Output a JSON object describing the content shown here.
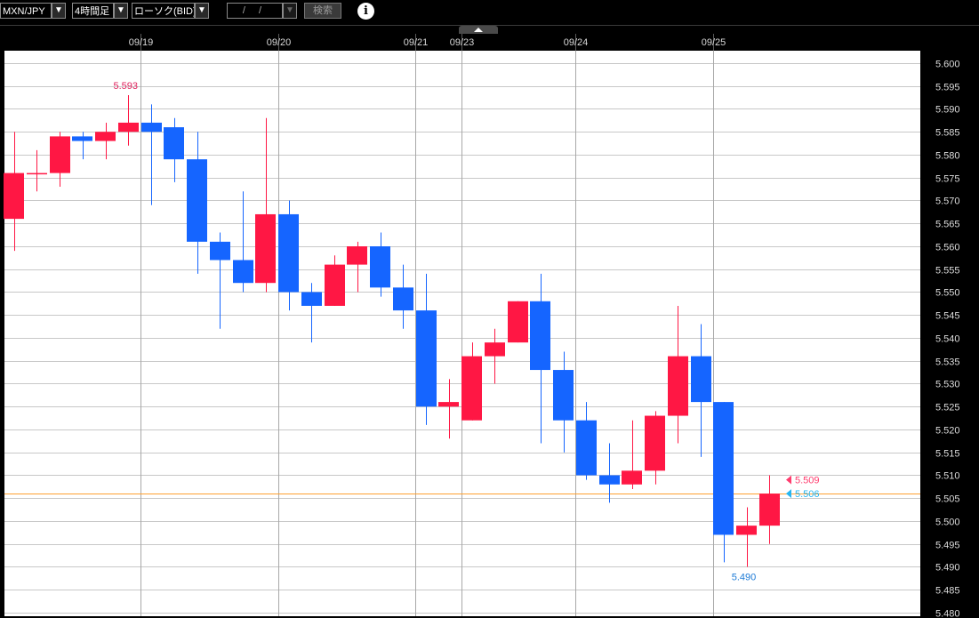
{
  "toolbar": {
    "symbol": "MXN/JPY",
    "timeframe": "4時間足",
    "chart_style": "ローソク(BID)",
    "date_input": "/ /",
    "search_label": "検索",
    "info_icon": "info-icon"
  },
  "colors": {
    "up": "#ff1744",
    "down": "#1565ff",
    "price_line": "#ffa030",
    "bid_marker": "#ff3c6e",
    "ask_marker": "#26b6f0",
    "background": "#000000",
    "plot": "#ffffff"
  },
  "chart_data": {
    "type": "candlestick",
    "title": "",
    "xlabel": "",
    "ylabel": "",
    "ylim": [
      5.488,
      5.602
    ],
    "y_ticks": [
      "5.600",
      "5.595",
      "5.590",
      "5.585",
      "5.580",
      "5.575",
      "5.570",
      "5.565",
      "5.560",
      "5.555",
      "5.550",
      "5.545",
      "5.540",
      "5.535",
      "5.530",
      "5.525",
      "5.520",
      "5.515",
      "5.510",
      "5.505",
      "5.500",
      "5.495",
      "5.490",
      "5.485",
      "5.480"
    ],
    "date_labels": [
      {
        "label": "09/19",
        "bar": 6
      },
      {
        "label": "09/20",
        "bar": 12
      },
      {
        "label": "09/21",
        "bar": 18
      },
      {
        "label": "09/23",
        "bar": 20
      },
      {
        "label": "09/24",
        "bar": 25
      },
      {
        "label": "09/25",
        "bar": 31
      }
    ],
    "candles": [
      {
        "o": 5.566,
        "h": 5.585,
        "l": 5.559,
        "c": 5.576
      },
      {
        "o": 5.576,
        "h": 5.581,
        "l": 5.572,
        "c": 5.576
      },
      {
        "o": 5.576,
        "h": 5.585,
        "l": 5.573,
        "c": 5.584
      },
      {
        "o": 5.584,
        "h": 5.585,
        "l": 5.579,
        "c": 5.583
      },
      {
        "o": 5.583,
        "h": 5.587,
        "l": 5.579,
        "c": 5.585
      },
      {
        "o": 5.585,
        "h": 5.593,
        "l": 5.582,
        "c": 5.587
      },
      {
        "o": 5.587,
        "h": 5.591,
        "l": 5.569,
        "c": 5.585
      },
      {
        "o": 5.586,
        "h": 5.588,
        "l": 5.574,
        "c": 5.579
      },
      {
        "o": 5.579,
        "h": 5.585,
        "l": 5.554,
        "c": 5.561
      },
      {
        "o": 5.561,
        "h": 5.563,
        "l": 5.542,
        "c": 5.557
      },
      {
        "o": 5.557,
        "h": 5.572,
        "l": 5.55,
        "c": 5.552
      },
      {
        "o": 5.552,
        "h": 5.588,
        "l": 5.55,
        "c": 5.567
      },
      {
        "o": 5.567,
        "h": 5.57,
        "l": 5.546,
        "c": 5.55
      },
      {
        "o": 5.55,
        "h": 5.552,
        "l": 5.539,
        "c": 5.547
      },
      {
        "o": 5.547,
        "h": 5.558,
        "l": 5.547,
        "c": 5.556
      },
      {
        "o": 5.556,
        "h": 5.561,
        "l": 5.55,
        "c": 5.56
      },
      {
        "o": 5.56,
        "h": 5.563,
        "l": 5.549,
        "c": 5.551
      },
      {
        "o": 5.551,
        "h": 5.556,
        "l": 5.542,
        "c": 5.546
      },
      {
        "o": 5.546,
        "h": 5.554,
        "l": 5.521,
        "c": 5.525
      },
      {
        "o": 5.525,
        "h": 5.531,
        "l": 5.518,
        "c": 5.526
      },
      {
        "o": 5.522,
        "h": 5.539,
        "l": 5.522,
        "c": 5.536
      },
      {
        "o": 5.536,
        "h": 5.542,
        "l": 5.53,
        "c": 5.539
      },
      {
        "o": 5.539,
        "h": 5.548,
        "l": 5.539,
        "c": 5.548
      },
      {
        "o": 5.548,
        "h": 5.554,
        "l": 5.517,
        "c": 5.533
      },
      {
        "o": 5.533,
        "h": 5.537,
        "l": 5.515,
        "c": 5.522
      },
      {
        "o": 5.522,
        "h": 5.526,
        "l": 5.509,
        "c": 5.51
      },
      {
        "o": 5.51,
        "h": 5.517,
        "l": 5.504,
        "c": 5.508
      },
      {
        "o": 5.508,
        "h": 5.522,
        "l": 5.507,
        "c": 5.511
      },
      {
        "o": 5.511,
        "h": 5.524,
        "l": 5.508,
        "c": 5.523
      },
      {
        "o": 5.523,
        "h": 5.547,
        "l": 5.517,
        "c": 5.536
      },
      {
        "o": 5.536,
        "h": 5.543,
        "l": 5.514,
        "c": 5.526
      },
      {
        "o": 5.526,
        "h": 5.526,
        "l": 5.491,
        "c": 5.497
      },
      {
        "o": 5.497,
        "h": 5.503,
        "l": 5.49,
        "c": 5.499
      },
      {
        "o": 5.499,
        "h": 5.51,
        "l": 5.495,
        "c": 5.506
      }
    ],
    "annotations": {
      "high_label": "5.593",
      "high_bar": 5,
      "high_value": 5.593,
      "low_label": "5.490",
      "low_bar": 32,
      "low_value": 5.49
    },
    "current_price": 5.506,
    "bid_label": "5.509",
    "bid_value": 5.509,
    "ask_label": "5.506",
    "ask_value": 5.506
  }
}
